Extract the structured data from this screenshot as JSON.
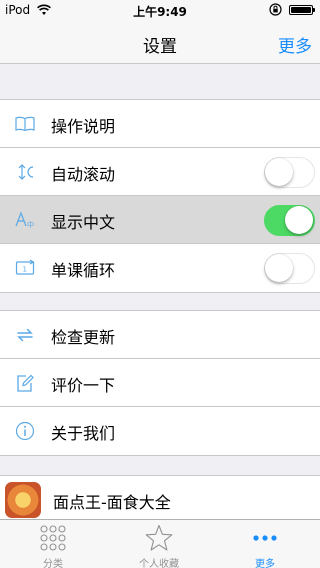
{
  "status_bar": {
    "carrier": "iPod",
    "time": "上午9:49"
  },
  "nav": {
    "title": "设置",
    "right_button": "更多"
  },
  "section1": [
    {
      "label": "操作说明",
      "icon": "book-icon"
    },
    {
      "label": "自动滚动",
      "icon": "scroll-icon",
      "switch": false
    },
    {
      "label": "显示中文",
      "icon": "translate-icon",
      "switch": true
    },
    {
      "label": "单课循环",
      "icon": "repeat-one-icon",
      "switch": false
    }
  ],
  "section2": [
    {
      "label": "检查更新",
      "icon": "refresh-icon"
    },
    {
      "label": "评价一下",
      "icon": "edit-icon"
    },
    {
      "label": "关于我们",
      "icon": "info-icon"
    }
  ],
  "app_promo": {
    "name": "面点王-面食大全"
  },
  "tabs": [
    {
      "label": "分类",
      "icon": "grid-icon"
    },
    {
      "label": "个人收藏",
      "icon": "star-icon"
    },
    {
      "label": "更多",
      "icon": "more-icon",
      "active": true
    }
  ],
  "colors": {
    "accent": "#1a8dfc",
    "switch_on": "#4cd964",
    "icon_blue": "#5aa9e6"
  }
}
